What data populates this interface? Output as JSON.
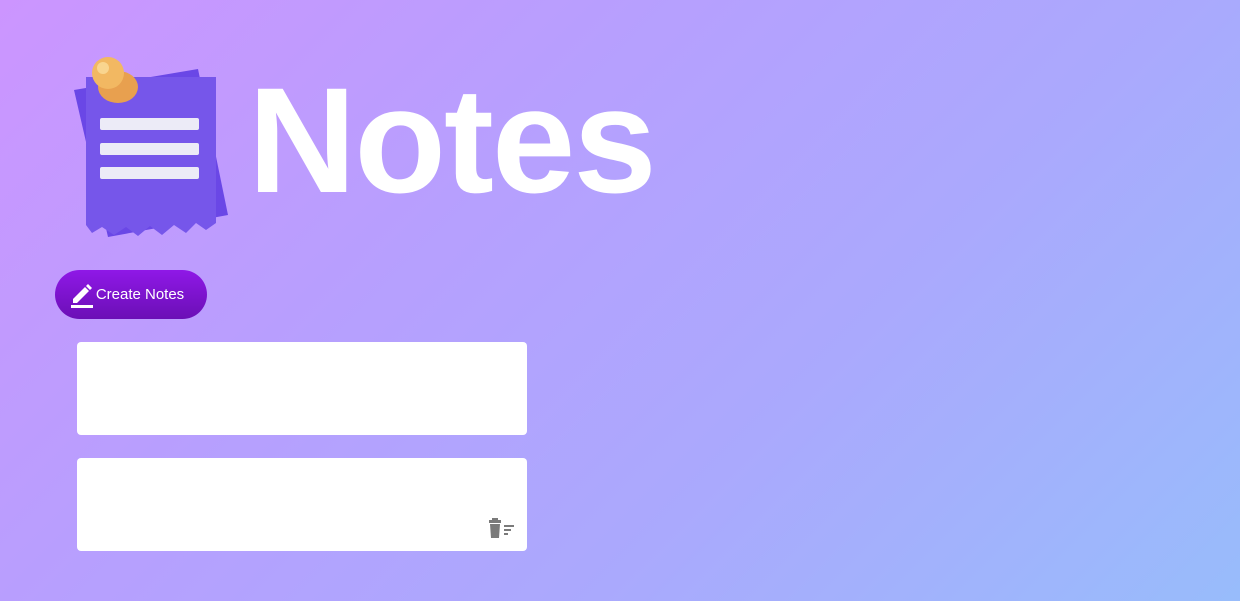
{
  "app": {
    "title": "Notes"
  },
  "toolbar": {
    "create_label": "Create Notes",
    "create_icon": "pencil-icon"
  },
  "notes": [
    {
      "text": "",
      "has_delete": false
    },
    {
      "text": "",
      "has_delete": true,
      "delete_icon": "delete-icon"
    }
  ],
  "colors": {
    "background_start": "#cc95ff",
    "background_end": "#98bcfb",
    "button_top": "#8f18e7",
    "button_bottom": "#6b0fb6",
    "note_bg": "#ffffff",
    "logo_paper": "#7456e8",
    "logo_pin": "#f2b862",
    "icon_gray": "#7a7a7a"
  }
}
